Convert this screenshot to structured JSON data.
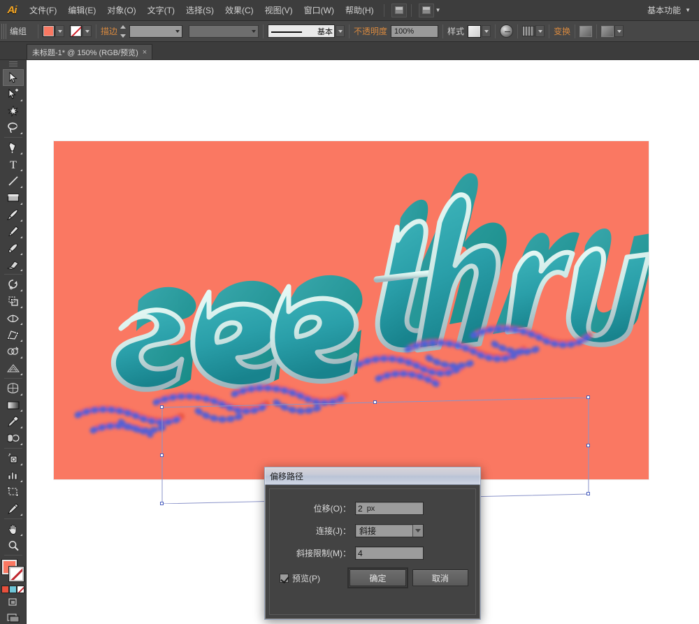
{
  "app": {
    "logo_text": "Ai",
    "workspace_label": "基本功能"
  },
  "menubar": {
    "items": [
      {
        "label": "文件(F)",
        "name": "menu-file"
      },
      {
        "label": "编辑(E)",
        "name": "menu-edit"
      },
      {
        "label": "对象(O)",
        "name": "menu-object"
      },
      {
        "label": "文字(T)",
        "name": "menu-type"
      },
      {
        "label": "选择(S)",
        "name": "menu-select"
      },
      {
        "label": "效果(C)",
        "name": "menu-effect"
      },
      {
        "label": "视图(V)",
        "name": "menu-view"
      },
      {
        "label": "窗口(W)",
        "name": "menu-window"
      },
      {
        "label": "帮助(H)",
        "name": "menu-help"
      }
    ],
    "bridge_icon": "bridge-icon",
    "arrange_icon": "arrange-documents-icon"
  },
  "controlbar": {
    "selection_label": "编组",
    "fill_label": "fill-swatch",
    "fill_color": "#fa7862",
    "stroke_label": "描边",
    "stroke_color": "none",
    "stroke_weight_value": "",
    "stroke_weight_placeholder": "",
    "brush_profile": "基本",
    "opacity_label": "不透明度",
    "opacity_value": "100%",
    "style_label": "样式",
    "transform_label": "变换",
    "align_icon": "align-icon",
    "recolor_icon": "recolor-artwork-icon",
    "isolate_icon": "isolate-group-icon",
    "draw_mode_icon": "draw-mode-icon"
  },
  "tabs": {
    "document": {
      "title": "未标题-1* @ 150% (RGB/预览)",
      "close": "×"
    }
  },
  "toolbar": {
    "tools": [
      {
        "name": "selection-tool",
        "label": "选择工具",
        "active": true
      },
      {
        "name": "direct-selection-tool",
        "label": "直接选择工具",
        "active": false
      },
      {
        "name": "magic-wand-tool",
        "label": "魔棒工具",
        "active": false
      },
      {
        "name": "lasso-tool",
        "label": "套索工具",
        "active": false
      },
      {
        "name": "pen-tool",
        "label": "钢笔工具",
        "active": false
      },
      {
        "name": "type-tool",
        "label": "文字工具",
        "active": false
      },
      {
        "name": "line-segment-tool",
        "label": "直线段工具",
        "active": false
      },
      {
        "name": "rectangle-tool",
        "label": "矩形工具",
        "active": false
      },
      {
        "name": "paintbrush-tool",
        "label": "画笔工具",
        "active": false
      },
      {
        "name": "pencil-tool",
        "label": "铅笔工具",
        "active": false
      },
      {
        "name": "blob-brush-tool",
        "label": "斑点画笔工具",
        "active": false
      },
      {
        "name": "eraser-tool",
        "label": "橡皮擦工具",
        "active": false
      },
      {
        "name": "rotate-tool",
        "label": "旋转工具",
        "active": false
      },
      {
        "name": "scale-tool",
        "label": "比例缩放工具",
        "active": false
      },
      {
        "name": "width-tool",
        "label": "宽度工具",
        "active": false
      },
      {
        "name": "free-transform-tool",
        "label": "自由变换工具",
        "active": false
      },
      {
        "name": "shape-builder-tool",
        "label": "形状生成器工具",
        "active": false
      },
      {
        "name": "perspective-grid-tool",
        "label": "透视网格工具",
        "active": false
      },
      {
        "name": "mesh-tool",
        "label": "网格工具",
        "active": false
      },
      {
        "name": "gradient-tool",
        "label": "渐变工具",
        "active": false
      },
      {
        "name": "eyedropper-tool",
        "label": "吸管工具",
        "active": false
      },
      {
        "name": "blend-tool",
        "label": "混合工具",
        "active": false
      },
      {
        "name": "symbol-sprayer-tool",
        "label": "符号喷枪工具",
        "active": false
      },
      {
        "name": "column-graph-tool",
        "label": "柱形图工具",
        "active": false
      },
      {
        "name": "artboard-tool",
        "label": "画板工具",
        "active": false
      },
      {
        "name": "slice-tool",
        "label": "切片工具",
        "active": false
      },
      {
        "name": "hand-tool",
        "label": "抓手工具",
        "active": false
      },
      {
        "name": "zoom-tool",
        "label": "缩放工具",
        "active": false
      }
    ],
    "fill_color": "#fa7862",
    "stroke_color": "none",
    "fill_stroke_name": "fill-and-stroke-swatch",
    "color_mode_icons": [
      "color-swatch-icon",
      "gradient-swatch-icon",
      "none-swatch-icon"
    ],
    "screen_mode_icon": "screen-mode-icon",
    "drawing_mode_icon": "drawing-mode-icon"
  },
  "artwork": {
    "word_1": "see",
    "word_2": "thru",
    "background_color": "#fa7862",
    "letter_face_color": "#2aa6ad",
    "letter_extrude_color": "#0d8f8a",
    "letter_outline_color": "#d8f6f2",
    "reflection_blue": "#4f5fd8",
    "reflection_red": "#e8503c",
    "selection_border_color": "#8a93c9",
    "selection_handle_color": "#ffffff"
  },
  "dialog": {
    "title": "偏移路径",
    "fields": [
      {
        "label": "位移(O)：",
        "value": "2",
        "unit": "px",
        "name": "offset-input"
      },
      {
        "label": "连接(J)：",
        "value": "斜接",
        "name": "joins-select"
      },
      {
        "label": "斜接限制(M)：",
        "value": "4",
        "unit": "",
        "name": "miter-limit-input"
      }
    ],
    "preview_label": "预览(P)",
    "preview_checked": true,
    "ok_label": "确定",
    "cancel_label": "取消"
  }
}
